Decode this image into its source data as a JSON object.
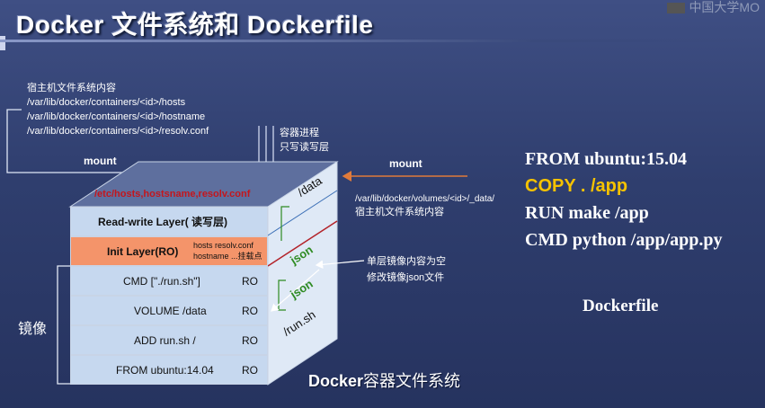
{
  "title": "Docker 文件系统和 Dockerfile",
  "logo_text": "中国大学MO",
  "host_note": {
    "heading": "宿主机文件系统内容",
    "lines": [
      "/var/lib/docker/containers/<id>/hosts",
      "/var/lib/docker/containers/<id>/hostname",
      "/var/lib/docker/containers/<id>/resolv.conf"
    ]
  },
  "process_note": [
    "容器进程",
    "只写读写层"
  ],
  "mount_left": "mount",
  "mount_right": "mount",
  "volume_note": {
    "path": "/var/lib/docker/volumes/<id>/_data/",
    "desc": "宿主机文件系统内容"
  },
  "json_note": [
    "单层镜像内容为空",
    "修改镜像json文件"
  ],
  "cube": {
    "top_label": "/etc/hosts,hostsname,resolv.conf",
    "layers": [
      {
        "label": "Read-write Layer( 读写层)",
        "ro": ""
      },
      {
        "label": "Init Layer(RO)",
        "ro": ""
      },
      {
        "label": "CMD [\"./run.sh\"]",
        "ro": "RO"
      },
      {
        "label": "VOLUME /data",
        "ro": "RO"
      },
      {
        "label": "ADD run.sh /",
        "ro": "RO"
      },
      {
        "label": "FROM ubuntu:14.04",
        "ro": "RO"
      }
    ],
    "init_notes": {
      "files1": "hosts  resolv.conf",
      "files2": "hostname ...挂载点"
    },
    "side_labels": {
      "data": "/data",
      "json1": "json",
      "json2": "json",
      "runsh": "/run.sh"
    }
  },
  "image_label": "镜像",
  "caption": {
    "bold": "Docker",
    "rest": "容器文件系统"
  },
  "dockerfile": {
    "lines": [
      "FROM ubuntu:15.04",
      "COPY . /app",
      "RUN make /app",
      "CMD python /app/app.py"
    ],
    "label": "Dockerfile"
  },
  "colors": {
    "background": "#34447a",
    "layer_fill": "#c6d8ef",
    "init_layer_fill": "#f4946a",
    "side_face": "#dfe9f6",
    "top_face": "#5e6f9e",
    "highlight": "#f5c200",
    "json_text": "#2e8b22",
    "etc_text": "#c4161c"
  }
}
